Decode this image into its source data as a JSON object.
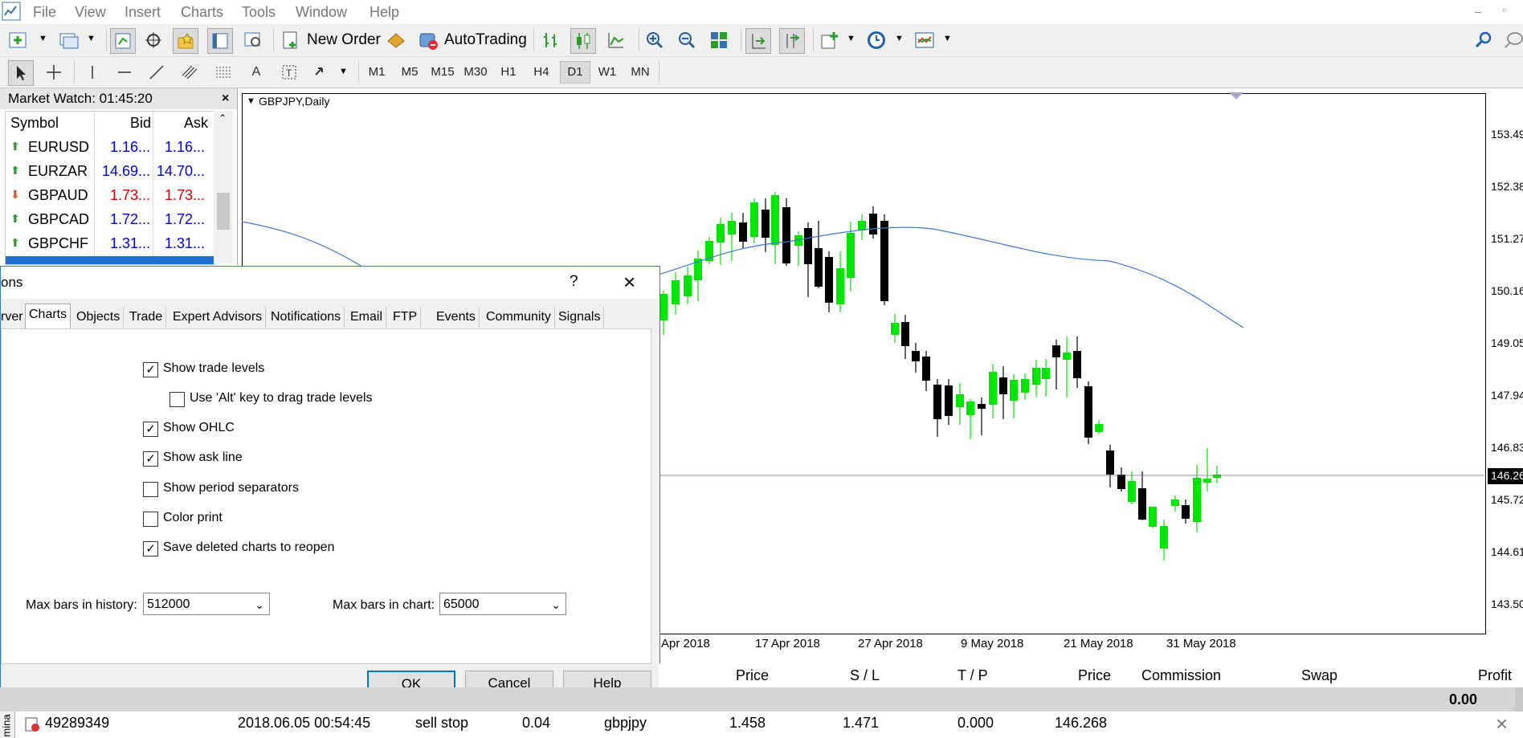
{
  "menubar": {
    "items": [
      "File",
      "View",
      "Insert",
      "Charts",
      "Tools",
      "Window",
      "Help"
    ]
  },
  "toolbar": {
    "new_order": "New Order",
    "autotrading": "AutoTrading",
    "timeframes": [
      "M1",
      "M5",
      "M15",
      "M30",
      "H1",
      "H4",
      "D1",
      "W1",
      "MN"
    ],
    "active_timeframe": "D1"
  },
  "market_watch": {
    "title": "Market Watch: 01:45:20",
    "headers": {
      "symbol": "Symbol",
      "bid": "Bid",
      "ask": "Ask"
    },
    "rows": [
      {
        "symbol": "EURUSD",
        "bid": "1.16...",
        "ask": "1.16...",
        "dir": "up",
        "color": "#0000e0"
      },
      {
        "symbol": "EURZAR",
        "bid": "14.69...",
        "ask": "14.70...",
        "dir": "up",
        "color": "#0000e0"
      },
      {
        "symbol": "GBPAUD",
        "bid": "1.73...",
        "ask": "1.73...",
        "dir": "down",
        "color": "#e00000"
      },
      {
        "symbol": "GBPCAD",
        "bid": "1.72...",
        "ask": "1.72...",
        "dir": "up",
        "color": "#0000e0"
      },
      {
        "symbol": "GBPCHF",
        "bid": "1.31...",
        "ask": "1.31...",
        "dir": "up",
        "color": "#0000e0"
      }
    ]
  },
  "chart": {
    "title": "GBPJPY,Daily",
    "price_labels": [
      "153.49",
      "152.38",
      "151.27",
      "150.16",
      "149.05",
      "147.94",
      "146.83",
      "146.26",
      "145.72",
      "144.61",
      "143.50"
    ],
    "current_price": "146.26",
    "date_labels": [
      "Apr 2018",
      "17 Apr 2018",
      "27 Apr 2018",
      "9 May 2018",
      "21 May 2018",
      "31 May 2018"
    ]
  },
  "dialog": {
    "title": "ons",
    "help_glyph": "?",
    "tabs": [
      "rver",
      "Charts",
      "Objects",
      "Trade",
      "Expert Advisors",
      "Notifications",
      "Email",
      "FTP",
      "Events",
      "Community",
      "Signals"
    ],
    "active_tab": "Charts",
    "options": [
      {
        "label": "Show trade levels",
        "checked": true
      },
      {
        "label": "Use 'Alt' key to drag trade levels",
        "checked": false
      },
      {
        "label": "Show OHLC",
        "checked": true
      },
      {
        "label": "Show ask line",
        "checked": true
      },
      {
        "label": "Show period separators",
        "checked": false
      },
      {
        "label": "Color print",
        "checked": false
      },
      {
        "label": "Save deleted charts to reopen",
        "checked": true
      }
    ],
    "max_bars_history_label": "Max bars in history:",
    "max_bars_history_value": "512000",
    "max_bars_chart_label": "Max bars in chart:",
    "max_bars_chart_value": "65000",
    "ok": "OK",
    "cancel": "Cancel",
    "help": "Help"
  },
  "terminal": {
    "headers": [
      "Price",
      "S / L",
      "T / P",
      "Price",
      "Commission",
      "Swap",
      "Profit"
    ],
    "total_profit": "0.00",
    "side_label": "mina",
    "order": {
      "ticket": "49289349",
      "time": "2018.06.05 00:54:45",
      "type": "sell stop",
      "size": "0.04",
      "symbol": "gbpjpy",
      "price": "1.458",
      "sl": "1.471",
      "tp": "0.000",
      "current_price": "146.268"
    }
  }
}
